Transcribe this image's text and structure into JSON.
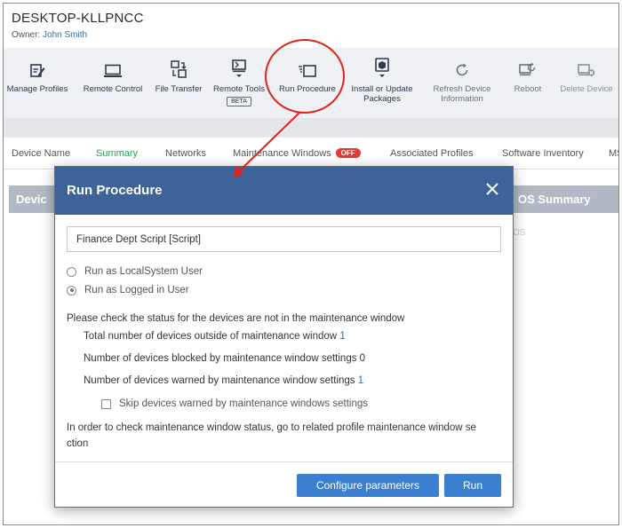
{
  "device": {
    "name": "DESKTOP-KLLPNCC",
    "owner_label": "Owner:",
    "owner_name": "John Smith"
  },
  "toolbar": {
    "manage_profiles": "Manage Profiles",
    "remote_control": "Remote Control",
    "file_transfer": "File Transfer",
    "remote_tools": "Remote Tools",
    "remote_tools_badge": "BETA",
    "run_procedure": "Run Procedure",
    "install_update_line1": "Install or Update",
    "install_update_line2": "Packages",
    "refresh_line1": "Refresh Device",
    "refresh_line2": "Information",
    "reboot": "Reboot",
    "delete_device": "Delete Device"
  },
  "tabs": {
    "device_name": "Device Name",
    "summary": "Summary",
    "networks": "Networks",
    "maintenance_windows": "Maintenance Windows",
    "maintenance_badge": "OFF",
    "associated_profiles": "Associated Profiles",
    "software_inventory": "Software Inventory",
    "more": "MS"
  },
  "grid": {
    "left_header": "Devic",
    "right_header": "OS Summary",
    "row_ghost": "OS"
  },
  "modal": {
    "title": "Run Procedure",
    "procedure_value": "Finance Dept Script [Script]",
    "radio_local": "Run as LocalSystem User",
    "radio_logged": "Run as Logged in User",
    "status_intro": "Please check the status for the devices are not in the maintenance window",
    "total_outside_label": "Total number of devices outside of maintenance window",
    "total_outside_value": "1",
    "blocked_label": "Number of devices blocked by maintenance window settings",
    "blocked_value": "0",
    "warned_label": "Number of devices warned by maintenance window settings",
    "warned_value": "1",
    "skip_label": "Skip devices warned by maintenance windows settings",
    "info_line1": "In order to check maintenance window status, go to related profile maintenance window se",
    "info_line2": "ction",
    "configure_button": "Configure parameters",
    "run_button": "Run"
  },
  "colors": {
    "modal_header": "#3e6398",
    "primary_button": "#3b7fd1",
    "active_tab": "#2aa05a",
    "off_badge": "#e53935",
    "link": "#1f6fb2",
    "annotation": "#e0231c"
  },
  "icons": {
    "manage_profiles": "edit-profile-icon",
    "remote_control": "monitor-icon",
    "file_transfer": "file-transfer-icon",
    "remote_tools": "remote-tools-icon",
    "run_procedure": "run-procedure-icon",
    "install_update": "package-icon",
    "refresh": "refresh-icon",
    "reboot": "reboot-icon",
    "delete_device": "delete-device-icon",
    "close": "close-icon"
  }
}
